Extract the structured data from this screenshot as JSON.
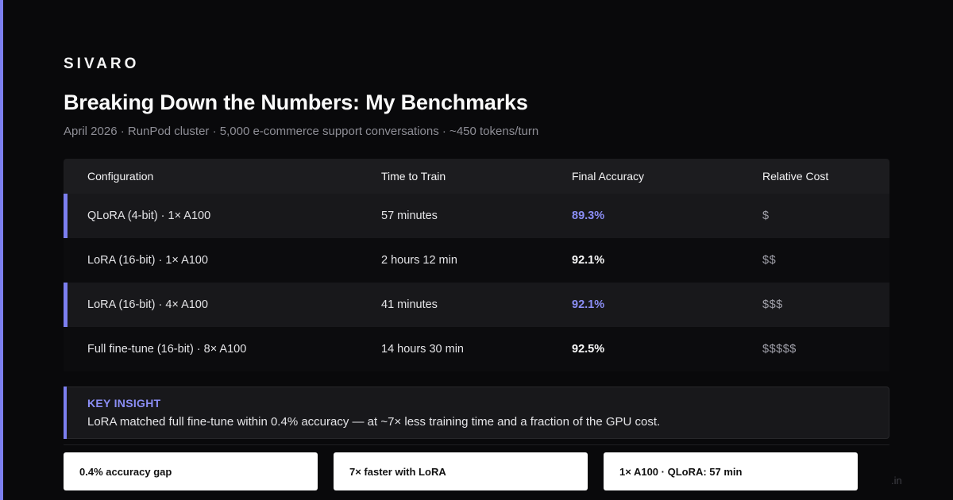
{
  "brand": "SIVARO",
  "title": "Breaking Down the Numbers: My Benchmarks",
  "subtitle": "April 2026 · RunPod cluster · 5,000 e-commerce support conversations · ~450 tokens/turn",
  "table": {
    "headers": [
      "Configuration",
      "Time to Train",
      "Final Accuracy",
      "Relative Cost"
    ],
    "rows": [
      {
        "config": "QLoRA (4-bit) · 1× A100",
        "time": "57 minutes",
        "accuracy": "89.3%",
        "cost": "$",
        "highlighted": true
      },
      {
        "config": "LoRA (16-bit) · 1× A100",
        "time": "2 hours 12 min",
        "accuracy": "92.1%",
        "cost": "$$",
        "highlighted": false
      },
      {
        "config": "LoRA (16-bit) · 4× A100",
        "time": "41 minutes",
        "accuracy": "92.1%",
        "cost": "$$$",
        "highlighted": true
      },
      {
        "config": "Full fine-tune (16-bit) · 8× A100",
        "time": "14 hours 30 min",
        "accuracy": "92.5%",
        "cost": "$$$$$",
        "highlighted": false
      }
    ]
  },
  "insight": {
    "label": "KEY INSIGHT",
    "text": "LoRA matched full fine-tune within 0.4% accuracy — at ~7× less training time and a fraction of the GPU cost."
  },
  "cards": [
    "0.4% accuracy gap",
    "7× faster with LoRA",
    "1× A100 · QLoRA: 57 min"
  ],
  "footer_mark": ".in",
  "colors": {
    "accent": "#7c7ff0",
    "background": "#09090b",
    "highlight_text": "#8b8ef5"
  }
}
